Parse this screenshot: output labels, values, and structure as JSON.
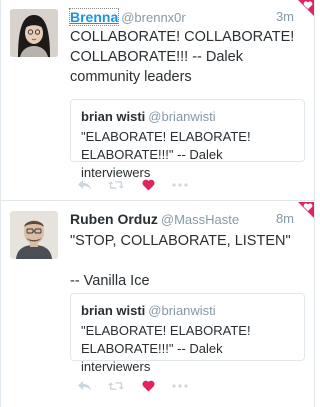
{
  "colors": {
    "accent": "#1b95e0",
    "heart": "#e0245e",
    "muted": "#8899a6",
    "text": "#292f33",
    "border": "#e1e8ed"
  },
  "tweets": [
    {
      "fullname": "Brenna",
      "username": "@brennx0r",
      "time": "3m",
      "text": "COLLABORATE! COLLABORATE!\nCOLLABORATE!!! -- Dalek\ncommunity leaders",
      "quote": {
        "name": "brian wisti",
        "username": "@brianwisti",
        "text": "\"ELABORATE! ELABORATE!\nELABORATE!!!\" -- Dalek interviewers"
      },
      "liked": true,
      "icons": [
        "reply-icon",
        "retweet-icon",
        "heart-icon",
        "more-icon"
      ]
    },
    {
      "fullname": "Ruben Orduz",
      "username": "@MassHaste",
      "time": "8m",
      "text": "\"STOP, COLLABORATE, LISTEN\"\n\n-- Vanilla Ice",
      "quote": {
        "name": "brian wisti",
        "username": "@brianwisti",
        "text": "\"ELABORATE! ELABORATE!\nELABORATE!!!\" -- Dalek interviewers"
      },
      "liked": true,
      "icons": [
        "reply-icon",
        "retweet-icon",
        "heart-icon",
        "more-icon"
      ]
    }
  ]
}
